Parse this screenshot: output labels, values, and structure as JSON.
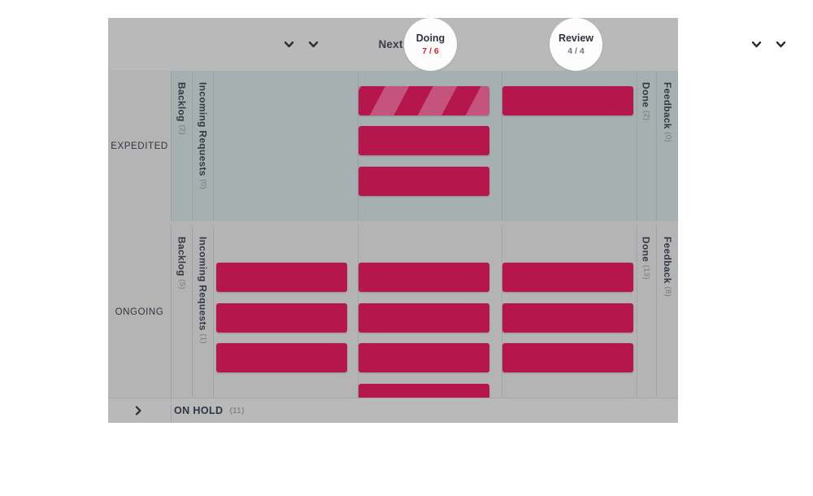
{
  "board": {
    "header": {
      "left_chevrons": [
        {
          "name": "chevron-down-icon-1"
        },
        {
          "name": "chevron-down-icon-2"
        }
      ],
      "right_chevrons": [
        {
          "name": "chevron-down-icon-3"
        },
        {
          "name": "chevron-down-icon-4"
        }
      ],
      "columns": [
        {
          "label": "Next",
          "type": "plain"
        },
        {
          "label": "Doing",
          "type": "wip",
          "count": "7 / 6",
          "over_limit": true
        },
        {
          "label": "Review",
          "type": "wip",
          "count": "4 / 4",
          "over_limit": false
        }
      ]
    },
    "lanes": [
      {
        "name": "EXPEDITED",
        "tinted": true,
        "left_strips": [
          {
            "label": "Backlog",
            "count": "(2)"
          },
          {
            "label": "Incoming Requests",
            "count": "(0)"
          }
        ],
        "right_strips": [
          {
            "label": "Done",
            "count": "(2)"
          },
          {
            "label": "Feedback",
            "count": "(0)"
          }
        ],
        "columns": [
          {
            "key": "next",
            "cards": []
          },
          {
            "key": "doing",
            "cards": [
              {
                "striped": true
              },
              {
                "striped": false
              },
              {
                "striped": false
              }
            ]
          },
          {
            "key": "review",
            "cards": [
              {
                "striped": false
              }
            ]
          }
        ]
      },
      {
        "name": "ONGOING",
        "tinted": false,
        "left_strips": [
          {
            "label": "Backlog",
            "count": "(5)"
          },
          {
            "label": "Incoming Requests",
            "count": "(1)"
          }
        ],
        "right_strips": [
          {
            "label": "Done",
            "count": "(13)"
          },
          {
            "label": "Feedback",
            "count": "(8)"
          }
        ],
        "columns": [
          {
            "key": "next",
            "cards": [
              {
                "striped": false
              },
              {
                "striped": false
              },
              {
                "striped": false
              }
            ]
          },
          {
            "key": "doing",
            "cards": [
              {
                "striped": false
              },
              {
                "striped": false
              },
              {
                "striped": false
              },
              {
                "striped": false
              }
            ]
          },
          {
            "key": "review",
            "cards": [
              {
                "striped": false
              },
              {
                "striped": false
              },
              {
                "striped": false
              }
            ]
          }
        ]
      }
    ],
    "collapsed_lane": {
      "label": "ON HOLD",
      "count": "(11)",
      "expand_icon": "chevron-right-icon"
    },
    "colors": {
      "card": "#b5164c",
      "card_stripe": "#c4547c",
      "lane_tint": "#a7b0b0",
      "lane_plain": "#b4b4b4",
      "header_bg": "#b9b9b9",
      "wip_over": "#d62121",
      "wip_ok": "#6e7680"
    }
  }
}
